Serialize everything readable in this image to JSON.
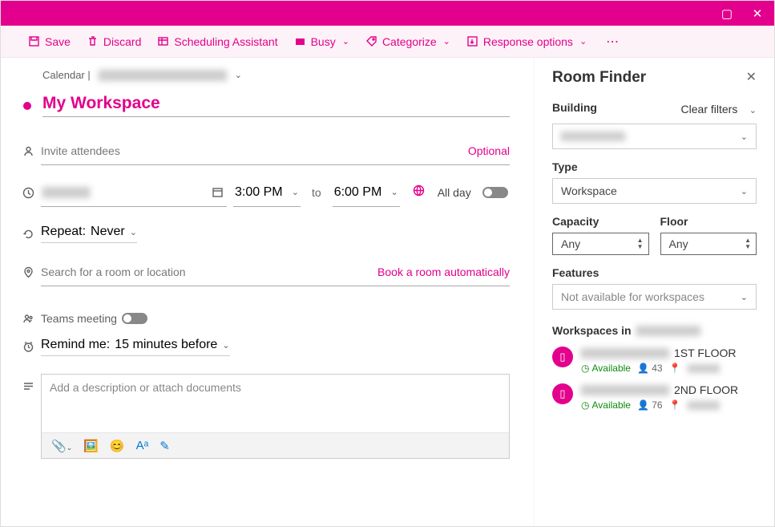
{
  "titlebar": {},
  "toolbar": {
    "save": "Save",
    "discard": "Discard",
    "scheduling": "Scheduling Assistant",
    "busy": "Busy",
    "categorize": "Categorize",
    "response": "Response options"
  },
  "breadcrumb": {
    "prefix": "Calendar |"
  },
  "title": "My Workspace",
  "attendees_placeholder": "Invite attendees",
  "optional_label": "Optional",
  "start_time": "3:00 PM",
  "to_label": "to",
  "end_time": "6:00 PM",
  "allday_label": "All day",
  "repeat_label": "Repeat:",
  "repeat_value": "Never",
  "location_placeholder": "Search for a room or location",
  "auto_book": "Book a room automatically",
  "teams_label": "Teams meeting",
  "remind_label": "Remind me:",
  "remind_value": "15 minutes before",
  "desc_placeholder": "Add a description or attach documents",
  "pane": {
    "title": "Room Finder",
    "building_label": "Building",
    "clear": "Clear filters",
    "type_label": "Type",
    "type_value": "Workspace",
    "capacity_label": "Capacity",
    "capacity_value": "Any",
    "floor_label": "Floor",
    "floor_value": "Any",
    "features_label": "Features",
    "features_value": "Not available for workspaces",
    "list_header": "Workspaces in",
    "items": [
      {
        "floor": "1ST FLOOR",
        "status": "Available",
        "capacity": "43"
      },
      {
        "floor": "2ND FLOOR",
        "status": "Available",
        "capacity": "76"
      }
    ]
  }
}
